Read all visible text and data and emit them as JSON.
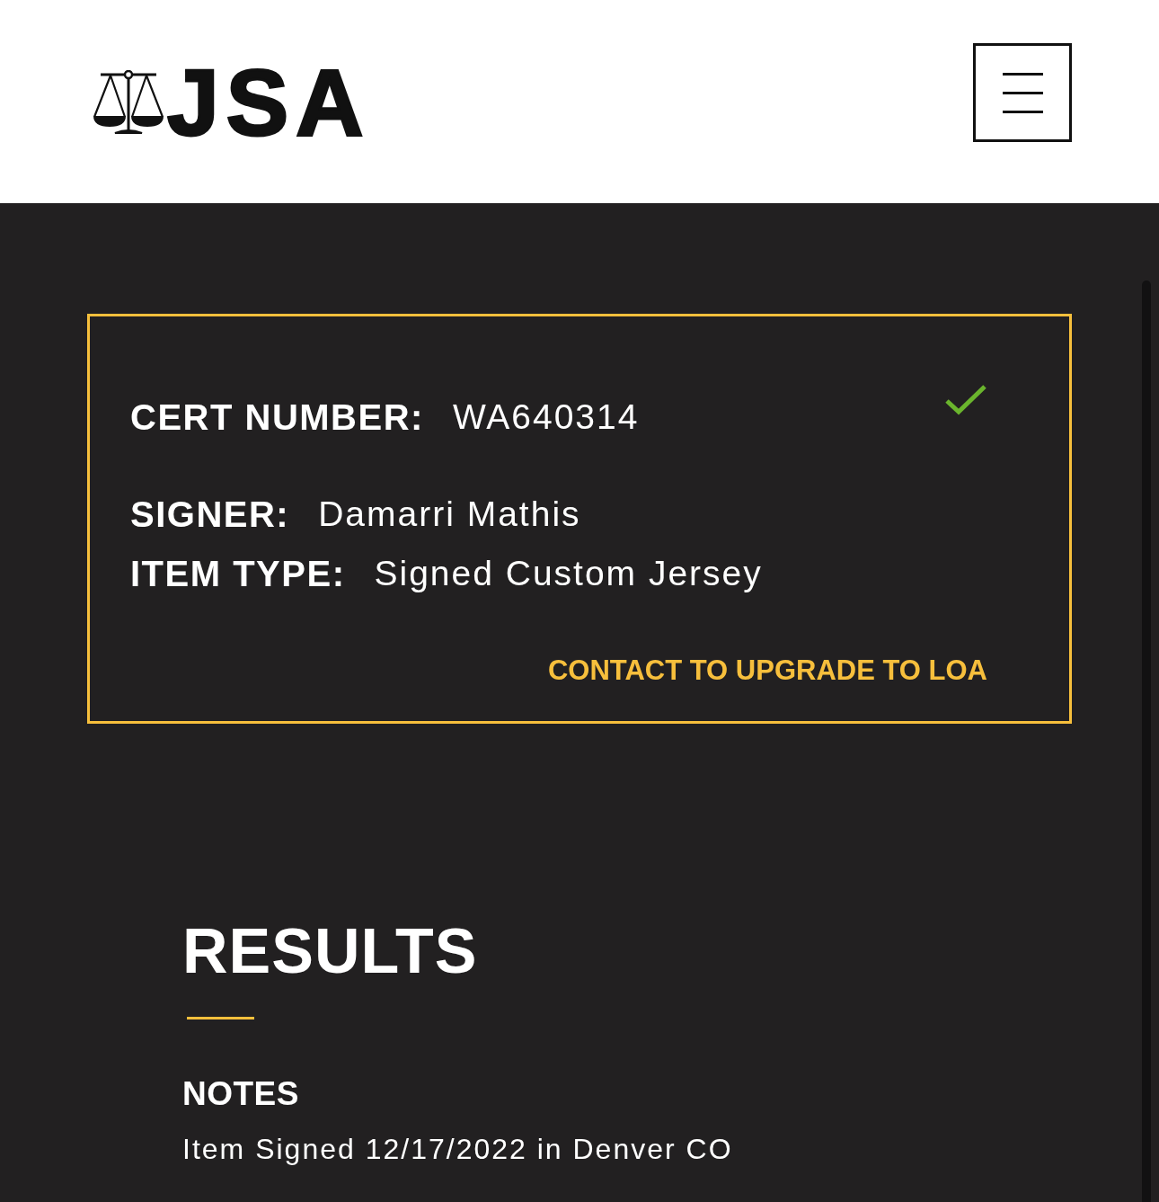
{
  "header": {
    "logo_text": "JSA"
  },
  "certificate": {
    "verified": true,
    "fields": [
      {
        "label": "CERT NUMBER:",
        "value": "WA640314"
      },
      {
        "label": "SIGNER:",
        "value": "Damarri Mathis"
      },
      {
        "label": "ITEM TYPE:",
        "value": "Signed Custom Jersey"
      }
    ],
    "upgrade_link": "CONTACT TO UPGRADE TO LOA"
  },
  "results": {
    "title": "RESULTS",
    "notes": {
      "heading": "NOTES",
      "text": "Item Signed 12/17/2022 in Denver CO"
    }
  }
}
